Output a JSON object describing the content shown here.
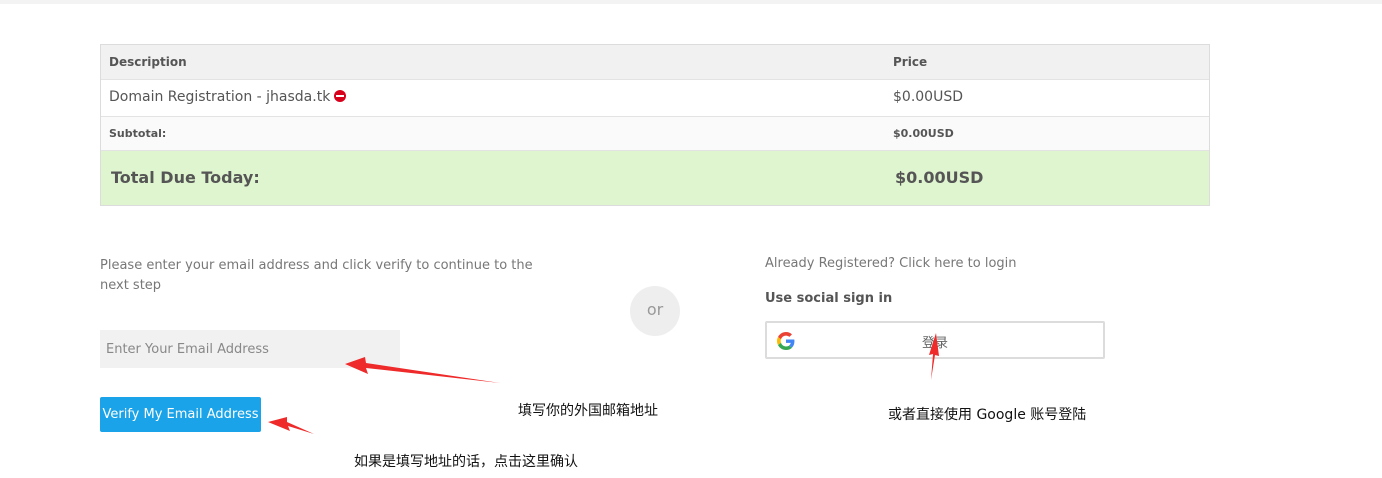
{
  "order_table": {
    "header": {
      "description": "Description",
      "price": "Price"
    },
    "items": [
      {
        "description": "Domain Registration - jhasda.tk",
        "price": "$0.00USD"
      }
    ],
    "subtotal": {
      "label": "Subtotal:",
      "value": "$0.00USD"
    },
    "total": {
      "label": "Total Due Today:",
      "value": "$0.00USD"
    }
  },
  "email_verify": {
    "instruction": "Please enter your email address and click verify to continue to the next step",
    "placeholder": "Enter Your Email Address",
    "button_label": "Verify My Email Address"
  },
  "separator": {
    "label": "or"
  },
  "login": {
    "link_text": "Already Registered? Click here to login",
    "social_title": "Use social sign in",
    "google_button_label": "登录"
  },
  "annotations": {
    "email_note": "填写你的外国邮箱地址",
    "verify_note": "如果是填写地址的话，点击这里确认",
    "google_note": "或者直接使用 Google 账号登陆"
  },
  "colors": {
    "total_bg": "#dff5cf",
    "verify_button": "#1aa3e8",
    "remove_icon": "#d9001b",
    "arrow": "#ee2a2a"
  }
}
